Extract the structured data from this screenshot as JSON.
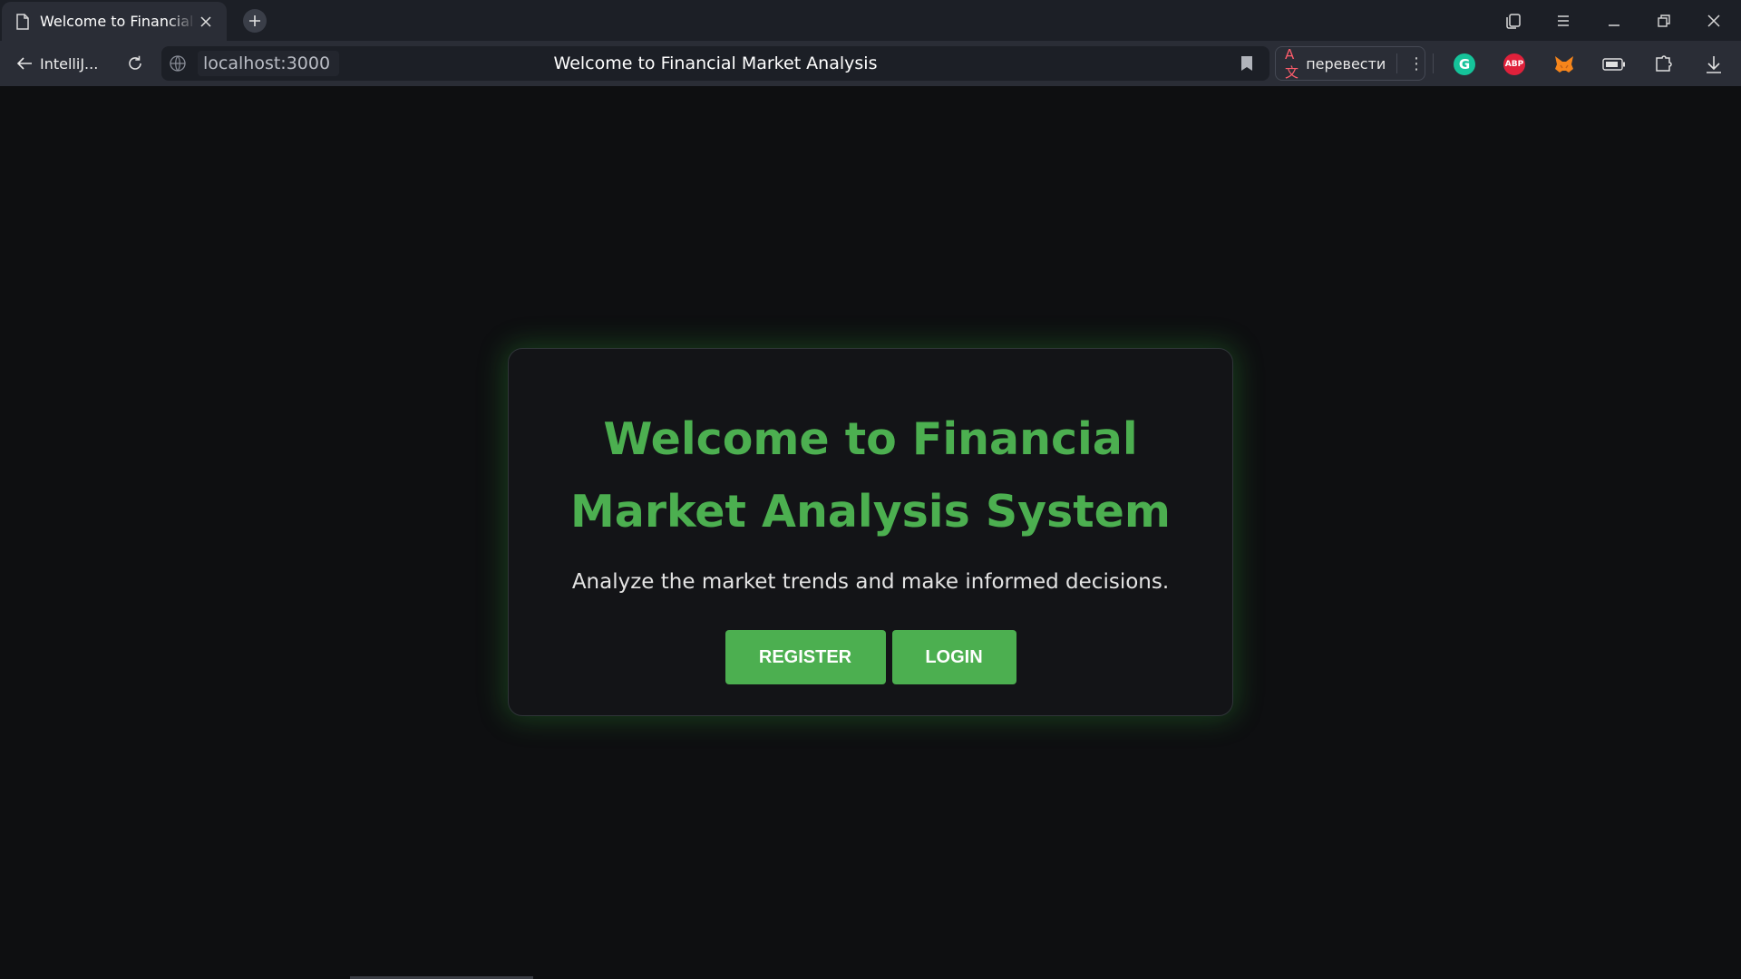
{
  "browser": {
    "tab": {
      "title": "Welcome to Financial Market Analysis"
    },
    "toolbar": {
      "back_label": "IntelliJ...",
      "url_host": "localhost:3000",
      "page_title": "Welcome to Financial Market Analysis",
      "translate_label": "перевести"
    },
    "extensions": [
      {
        "name": "grammarly-icon",
        "glyph": "G"
      },
      {
        "name": "adblock-plus-icon",
        "glyph": "ABP"
      },
      {
        "name": "metamask-icon"
      },
      {
        "name": "battery-icon"
      },
      {
        "name": "extensions-icon"
      },
      {
        "name": "download-icon"
      }
    ]
  },
  "page": {
    "heading": "Welcome to Financial Market Analysis System",
    "subtitle": "Analyze the market trends and make informed decisions.",
    "register_label": "REGISTER",
    "login_label": "LOGIN"
  },
  "colors": {
    "accent": "#4caf50",
    "background": "#0e0f11",
    "card": "#131417"
  }
}
